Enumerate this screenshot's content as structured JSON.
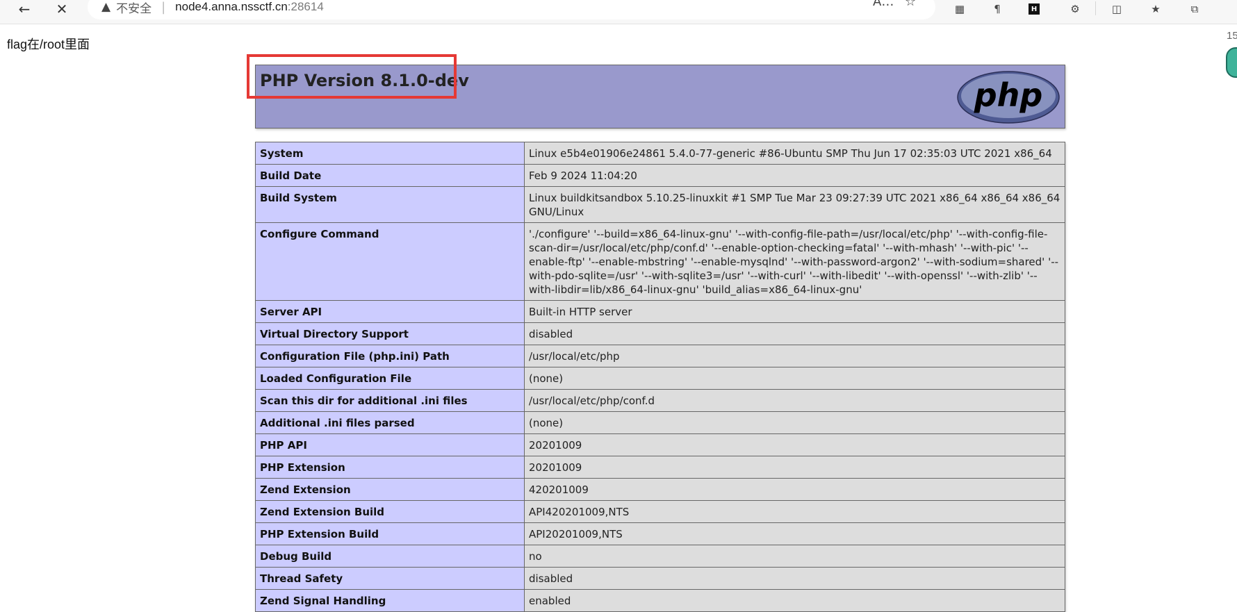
{
  "browser": {
    "insecure_label": "不安全",
    "url_host": "node4.anna.nssctf.cn",
    "url_port": ":28614"
  },
  "page": {
    "note": "flag在/root里面",
    "edge_number": "15"
  },
  "phpinfo": {
    "version_title": "PHP Version 8.1.0-dev",
    "logo_text": "php",
    "rows": [
      {
        "label": "System",
        "value": "Linux e5b4e01906e24861 5.4.0-77-generic #86-Ubuntu SMP Thu Jun 17 02:35:03 UTC 2021 x86_64"
      },
      {
        "label": "Build Date",
        "value": "Feb 9 2024 11:04:20"
      },
      {
        "label": "Build System",
        "value": "Linux buildkitsandbox 5.10.25-linuxkit #1 SMP Tue Mar 23 09:27:39 UTC 2021 x86_64 x86_64 x86_64 GNU/Linux"
      },
      {
        "label": "Configure Command",
        "value": "'./configure' '--build=x86_64-linux-gnu' '--with-config-file-path=/usr/local/etc/php' '--with-config-file-scan-dir=/usr/local/etc/php/conf.d' '--enable-option-checking=fatal' '--with-mhash' '--with-pic' '--enable-ftp' '--enable-mbstring' '--enable-mysqlnd' '--with-password-argon2' '--with-sodium=shared' '--with-pdo-sqlite=/usr' '--with-sqlite3=/usr' '--with-curl' '--with-libedit' '--with-openssl' '--with-zlib' '--with-libdir=lib/x86_64-linux-gnu' 'build_alias=x86_64-linux-gnu'"
      },
      {
        "label": "Server API",
        "value": "Built-in HTTP server"
      },
      {
        "label": "Virtual Directory Support",
        "value": "disabled"
      },
      {
        "label": "Configuration File (php.ini) Path",
        "value": "/usr/local/etc/php"
      },
      {
        "label": "Loaded Configuration File",
        "value": "(none)"
      },
      {
        "label": "Scan this dir for additional .ini files",
        "value": "/usr/local/etc/php/conf.d"
      },
      {
        "label": "Additional .ini files parsed",
        "value": "(none)"
      },
      {
        "label": "PHP API",
        "value": "20201009"
      },
      {
        "label": "PHP Extension",
        "value": "20201009"
      },
      {
        "label": "Zend Extension",
        "value": "420201009"
      },
      {
        "label": "Zend Extension Build",
        "value": "API420201009,NTS"
      },
      {
        "label": "PHP Extension Build",
        "value": "API20201009,NTS"
      },
      {
        "label": "Debug Build",
        "value": "no"
      },
      {
        "label": "Thread Safety",
        "value": "disabled"
      },
      {
        "label": "Zend Signal Handling",
        "value": "enabled"
      }
    ]
  }
}
